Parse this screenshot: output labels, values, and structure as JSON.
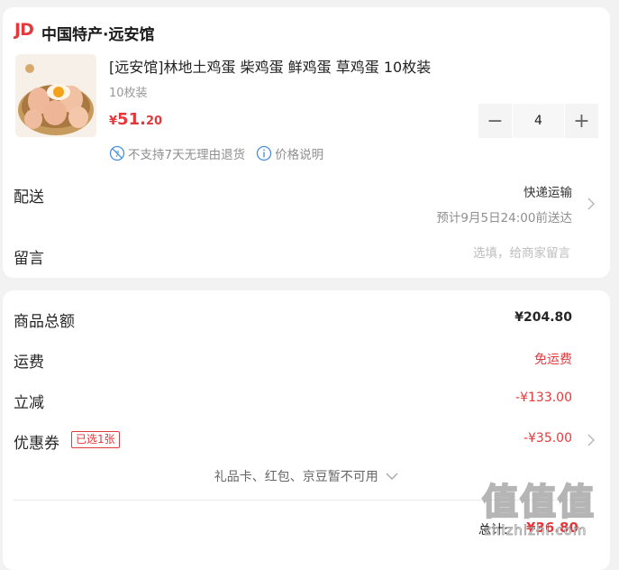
{
  "store": {
    "logo_text": "JD",
    "name": "中国特产·远安馆"
  },
  "product": {
    "image_icon": "egg-basket-image",
    "title": "[远安馆]林地土鸡蛋 柴鸡蛋 鲜鸡蛋 草鸡蛋 10枚装",
    "spec": "10枚装",
    "price_currency": "¥",
    "price_int": "51.",
    "price_dec": "20",
    "quantity": "4",
    "minus_label": "−",
    "plus_label": "+",
    "notice_return": "不支持7天无理由退货",
    "notice_price": "价格说明"
  },
  "delivery": {
    "label": "配送",
    "method": "快递运输",
    "eta": "预计9月5日24:00前送达"
  },
  "message": {
    "label": "留言",
    "placeholder": "选填，给商家留言"
  },
  "summary": {
    "goods_total_label": "商品总额",
    "goods_total_value": "¥204.80",
    "freight_label": "运费",
    "freight_value": "免运费",
    "discount_label": "立减",
    "discount_value": "-¥133.00",
    "coupon_label": "优惠券",
    "coupon_badge": "已选1张",
    "coupon_value": "-¥35.00",
    "giftcard_text": "礼品卡、红包、京豆暂不可用",
    "total_label": "总计:",
    "total_value": "¥36.80"
  },
  "watermark": {
    "glyphs": "值值值",
    "text": "zhizhizhi.com"
  },
  "colors": {
    "accent": "#e4393c",
    "muted": "#999999",
    "background": "#f2f2f2"
  }
}
